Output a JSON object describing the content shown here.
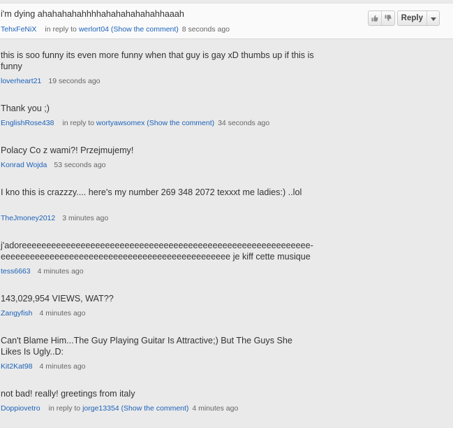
{
  "comments": [
    {
      "text": "i'm dying ahahahahahhhhahahahahahahhaaah",
      "author": "TehxFeNiX",
      "reply_prefix": "in reply to",
      "reply_target": "werlort04",
      "show_comment": "(Show the comment)",
      "time": "8 seconds ago",
      "highlighted": true,
      "actions": {
        "like_icon": "thumbs-up-icon",
        "dislike_icon": "thumbs-down-icon",
        "reply_label": "Reply",
        "menu_icon": "chevron-down-icon"
      }
    },
    {
      "text": "this is soo funny its even more funny when that guy is gay xD thumbs up if this is funny",
      "author": "loverheart21",
      "time": "19 seconds ago"
    },
    {
      "text": "Thank you ;)",
      "author": "EnglishRose438",
      "reply_prefix": "in reply to",
      "reply_target": "wortyawsomex",
      "show_comment": "(Show the comment)",
      "time": "34 seconds ago"
    },
    {
      "text": "Polacy Co z wami?! Przejmujemy!",
      "author": "Konrad Wojda",
      "time": "53 seconds ago"
    },
    {
      "text": "I kno this is crazzzy.... here's my number 269 348 2072 texxxt me ladies:) ..lol",
      "author": "TheJmoney2012",
      "time": "3 minutes ago"
    },
    {
      "text": "j'adoreeeeeeeeeeeeeeeeeeeeeeeeeeeeeeeeeeeeeeeeeeeeeeeeeeeeeeeeeee-\neeeeeeeeeeeeeeeeeeeeeeeeeeeeeeeeeeeeeeeeeeeeeee je kiff cette musique",
      "author": "tess6663",
      "time": "4 minutes ago"
    },
    {
      "text": "143,029,954 VIEWS, WAT??",
      "author": "Zangyfish",
      "time": "4 minutes ago"
    },
    {
      "text": "Can't Blame Him...The Guy Playing Guitar Is Attractive;) But The Guys She Likes Is Ugly..D:",
      "author": "Kit2Kat98",
      "time": "4 minutes ago"
    },
    {
      "text": "not bad! really! greetings from italy",
      "author": "Doppiovetro",
      "reply_prefix": "in reply to",
      "reply_target": "jorge13354",
      "show_comment": "(Show the comment)",
      "time": "4 minutes ago"
    }
  ]
}
